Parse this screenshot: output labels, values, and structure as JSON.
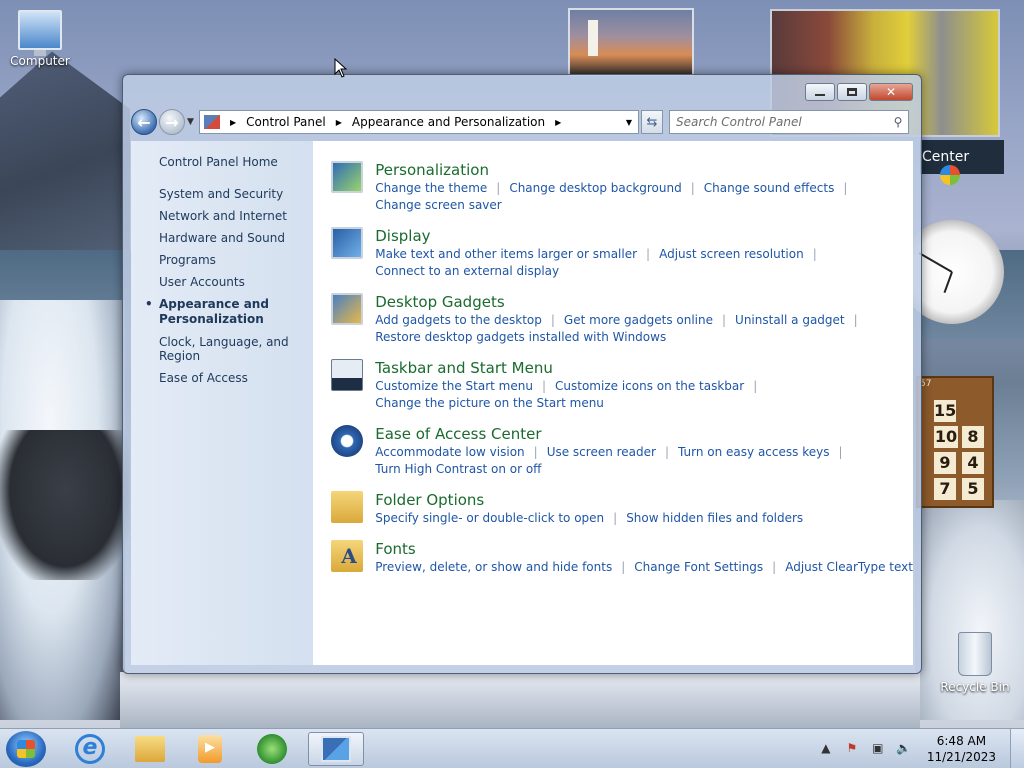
{
  "desktop": {
    "icons": [
      {
        "label": "Computer"
      },
      {
        "label": "Recycle Bin"
      }
    ],
    "feed_gadget_label": "Center"
  },
  "window": {
    "breadcrumb": [
      "Control Panel",
      "Appearance and Personalization"
    ],
    "search_placeholder": "Search Control Panel"
  },
  "sidebar": {
    "home": "Control Panel Home",
    "items": [
      "System and Security",
      "Network and Internet",
      "Hardware and Sound",
      "Programs",
      "User Accounts",
      "Appearance and Personalization",
      "Clock, Language, and Region",
      "Ease of Access"
    ],
    "active_index": 5
  },
  "categories": [
    {
      "title": "Personalization",
      "icon": "personalization-icon",
      "links": [
        "Change the theme",
        "Change desktop background",
        "Change sound effects",
        "Change screen saver"
      ]
    },
    {
      "title": "Display",
      "icon": "display-icon",
      "links": [
        "Make text and other items larger or smaller",
        "Adjust screen resolution",
        "Connect to an external display"
      ]
    },
    {
      "title": "Desktop Gadgets",
      "icon": "gadgets-icon",
      "links": [
        "Add gadgets to the desktop",
        "Get more gadgets online",
        "Uninstall a gadget",
        "Restore desktop gadgets installed with Windows"
      ]
    },
    {
      "title": "Taskbar and Start Menu",
      "icon": "taskbar-icon",
      "links": [
        "Customize the Start menu",
        "Customize icons on the taskbar",
        "Change the picture on the Start menu"
      ]
    },
    {
      "title": "Ease of Access Center",
      "icon": "ease-of-access-icon",
      "links": [
        "Accommodate low vision",
        "Use screen reader",
        "Turn on easy access keys",
        "Turn High Contrast on or off"
      ]
    },
    {
      "title": "Folder Options",
      "icon": "folder-options-icon",
      "links": [
        "Specify single- or double-click to open",
        "Show hidden files and folders"
      ]
    },
    {
      "title": "Fonts",
      "icon": "fonts-icon",
      "links": [
        "Preview, delete, or show and hide fonts",
        "Change Font Settings",
        "Adjust ClearType text"
      ]
    }
  ],
  "puzzle": {
    "tiles": [
      "15",
      "10",
      "8",
      "9",
      "4",
      "7",
      "5"
    ],
    "counter": "57"
  },
  "taskbar": {
    "time": "6:48 AM",
    "date": "11/21/2023"
  },
  "colors": {
    "category_title": "#1a6b2e",
    "link": "#1f56a6",
    "sidebar_text": "#1e395b"
  }
}
